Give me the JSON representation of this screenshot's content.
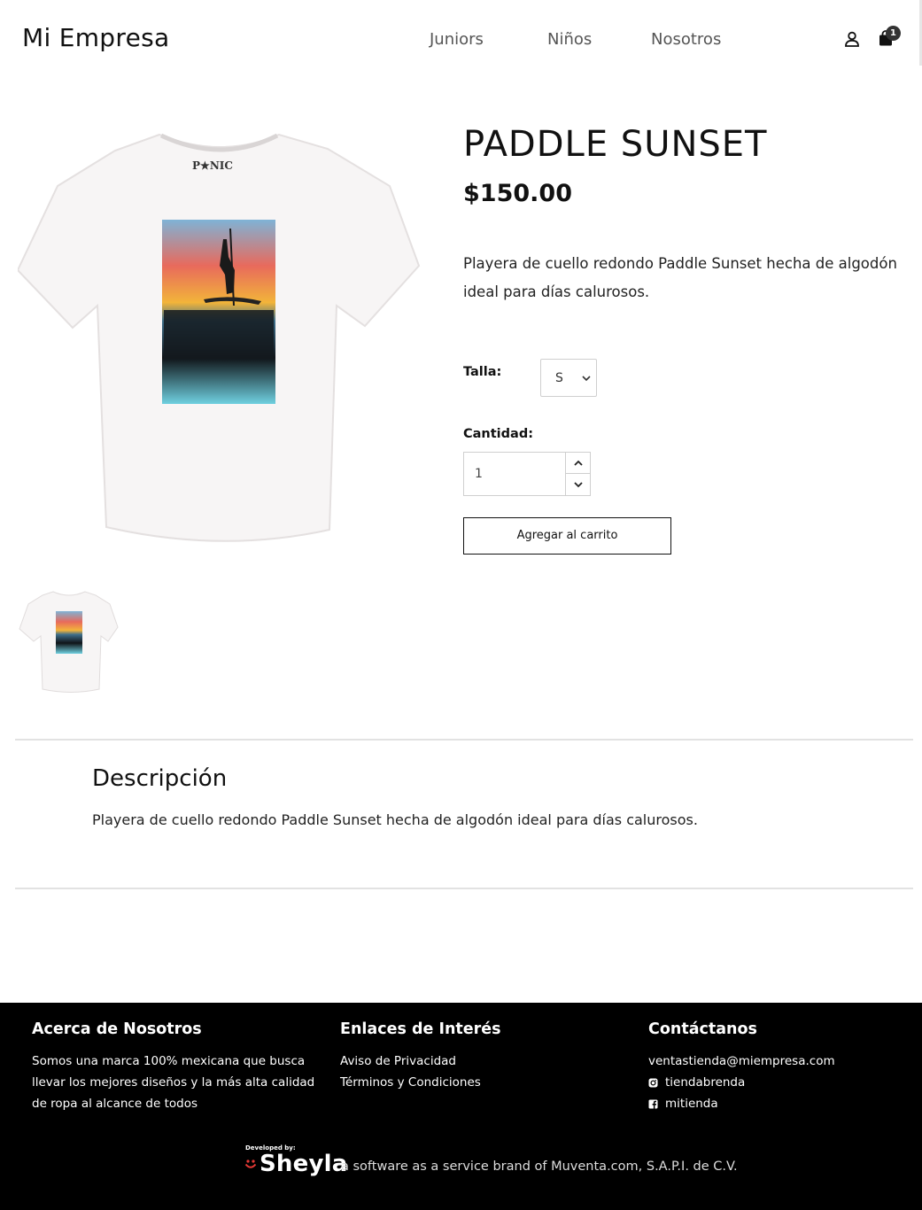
{
  "header": {
    "logo": "Mi Empresa",
    "nav": [
      "Juniors",
      "Niños",
      "Nosotros"
    ],
    "user_icon": "user-icon",
    "cart_icon": "shopping-bag-icon",
    "cart_count": "1"
  },
  "product": {
    "title": "PADDLE SUNSET",
    "price": "$150.00",
    "short_description": "Playera de cuello redondo Paddle Sunset hecha de algodón ideal para días calurosos.",
    "image_brand": "P★NIC",
    "size_label": "Talla:",
    "size_selected": "S",
    "quantity_label": "Cantidad:",
    "quantity_value": "1",
    "add_to_cart": "Agregar al carrito"
  },
  "description": {
    "heading": "Descripción",
    "body": "Playera de cuello redondo Paddle Sunset hecha de algodón ideal para días calurosos."
  },
  "footer": {
    "about": {
      "heading": "Acerca de Nosotros",
      "text": "Somos una marca 100% mexicana que busca llevar los mejores diseños y la más alta calidad de ropa al alcance de todos"
    },
    "links": {
      "heading": "Enlaces de Interés",
      "items": [
        "Aviso de Privacidad",
        "Términos y Condiciones"
      ]
    },
    "contact": {
      "heading": "Contáctanos",
      "email": "ventastienda@miempresa.com",
      "instagram": "tiendabrenda",
      "facebook": "mitienda"
    },
    "developed_by": "Developed by:",
    "brand_name": "Sheyla",
    "brand_tagline": "a software as a service brand of Muventa.com, S.A.P.I. de C.V."
  },
  "colors": {
    "text": "#111111",
    "nav_text": "#555555",
    "footer_bg": "#000000",
    "divider": "#e2e2e2",
    "brand_accent": "#e53935"
  }
}
